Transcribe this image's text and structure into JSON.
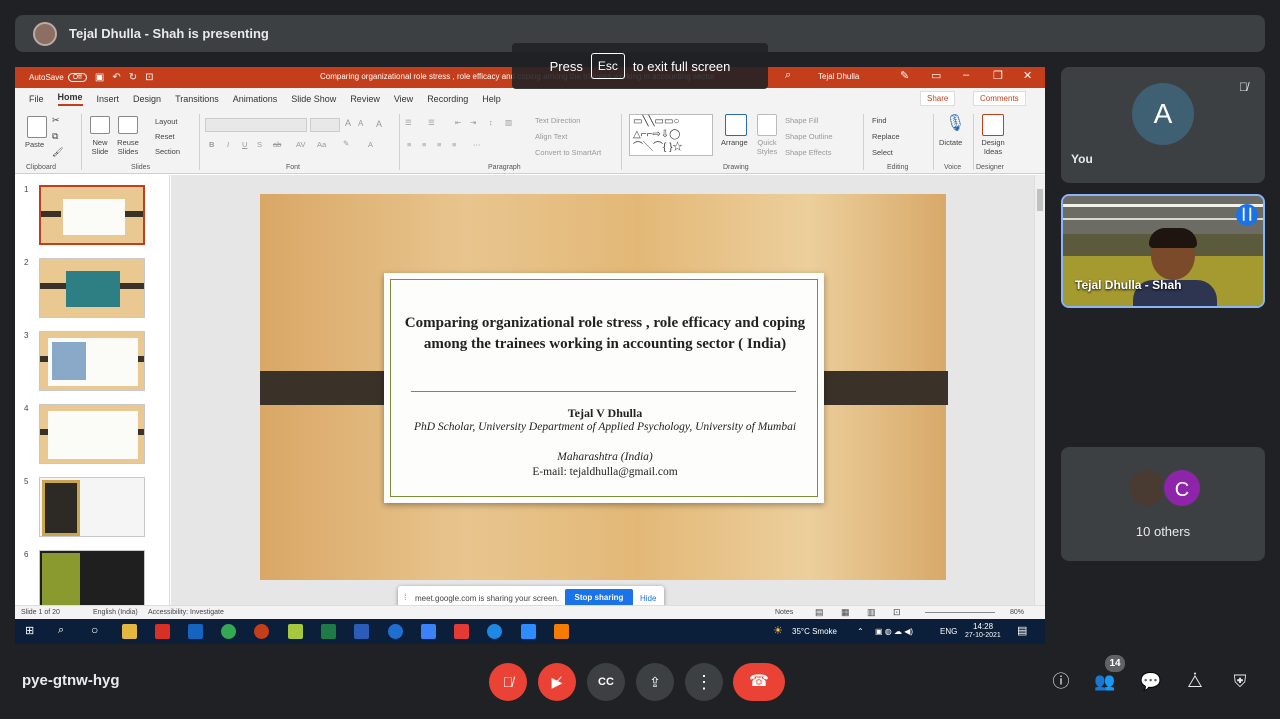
{
  "banner": {
    "presenter_text": "Tejal Dhulla - Shah is presenting"
  },
  "fullscreen_hint": {
    "press": "Press",
    "key": "Esc",
    "suffix": "to exit full screen"
  },
  "ppt": {
    "autosave": "AutoSave",
    "autosave_state": "Off",
    "doc_title": "Comparing organizational role stress , role efficacy and coping among the trainees working in accounting  sector",
    "user": "Tejal Dhulla",
    "menu": [
      "File",
      "Home",
      "Insert",
      "Design",
      "Transitions",
      "Animations",
      "Slide Show",
      "Review",
      "View",
      "Recording",
      "Help"
    ],
    "share": "Share",
    "comments": "Comments",
    "ribbon": {
      "paste": "Paste",
      "new_slide": "New Slide",
      "reuse_slides": "Reuse Slides",
      "layout": "Layout",
      "reset": "Reset",
      "section": "Section",
      "text_direction": "Text Direction",
      "align_text": "Align Text",
      "convert_smartart": "Convert to SmartArt",
      "arrange": "Arrange",
      "quick_styles": "Quick Styles",
      "shape_fill": "Shape Fill",
      "shape_outline": "Shape Outline",
      "shape_effects": "Shape Effects",
      "find": "Find",
      "replace": "Replace",
      "select": "Select",
      "dictate": "Dictate",
      "design_ideas": "Design Ideas",
      "groups": [
        "Clipboard",
        "Slides",
        "Font",
        "Paragraph",
        "Drawing",
        "Editing",
        "Voice",
        "Designer"
      ]
    },
    "thumbnails": [
      "1",
      "2",
      "3",
      "4",
      "5",
      "6"
    ],
    "slide": {
      "title": "Comparing organizational role stress , role efficacy and coping among the trainees working in accounting  sector ( India)",
      "author": "Tejal V Dhulla",
      "affiliation": "PhD Scholar, University Department of Applied Psychology, University of Mumbai",
      "location": "Maharashtra (India)",
      "email": "E-mail:  tejaldhulla@gmail.com"
    },
    "share_bar": {
      "message": "meet.google.com is sharing your screen.",
      "stop": "Stop sharing",
      "hide": "Hide"
    },
    "status": {
      "slide_of": "Slide 1 of 20",
      "language": "English (India)",
      "accessibility": "Accessibility: Investigate",
      "notes": "Notes",
      "zoom": "80%"
    },
    "taskbar": {
      "weather": "35°C  Smoke",
      "lang": "ENG",
      "time": "14:28",
      "date": "27-10-2021"
    }
  },
  "participants": {
    "you": {
      "initial": "A",
      "name": "You"
    },
    "presenter": {
      "name": "Tejal Dhulla - Shah"
    },
    "others": {
      "initial": "C",
      "label": "10 others"
    }
  },
  "meeting": {
    "code": "pye-gtnw-hyg",
    "participant_count": "14"
  }
}
